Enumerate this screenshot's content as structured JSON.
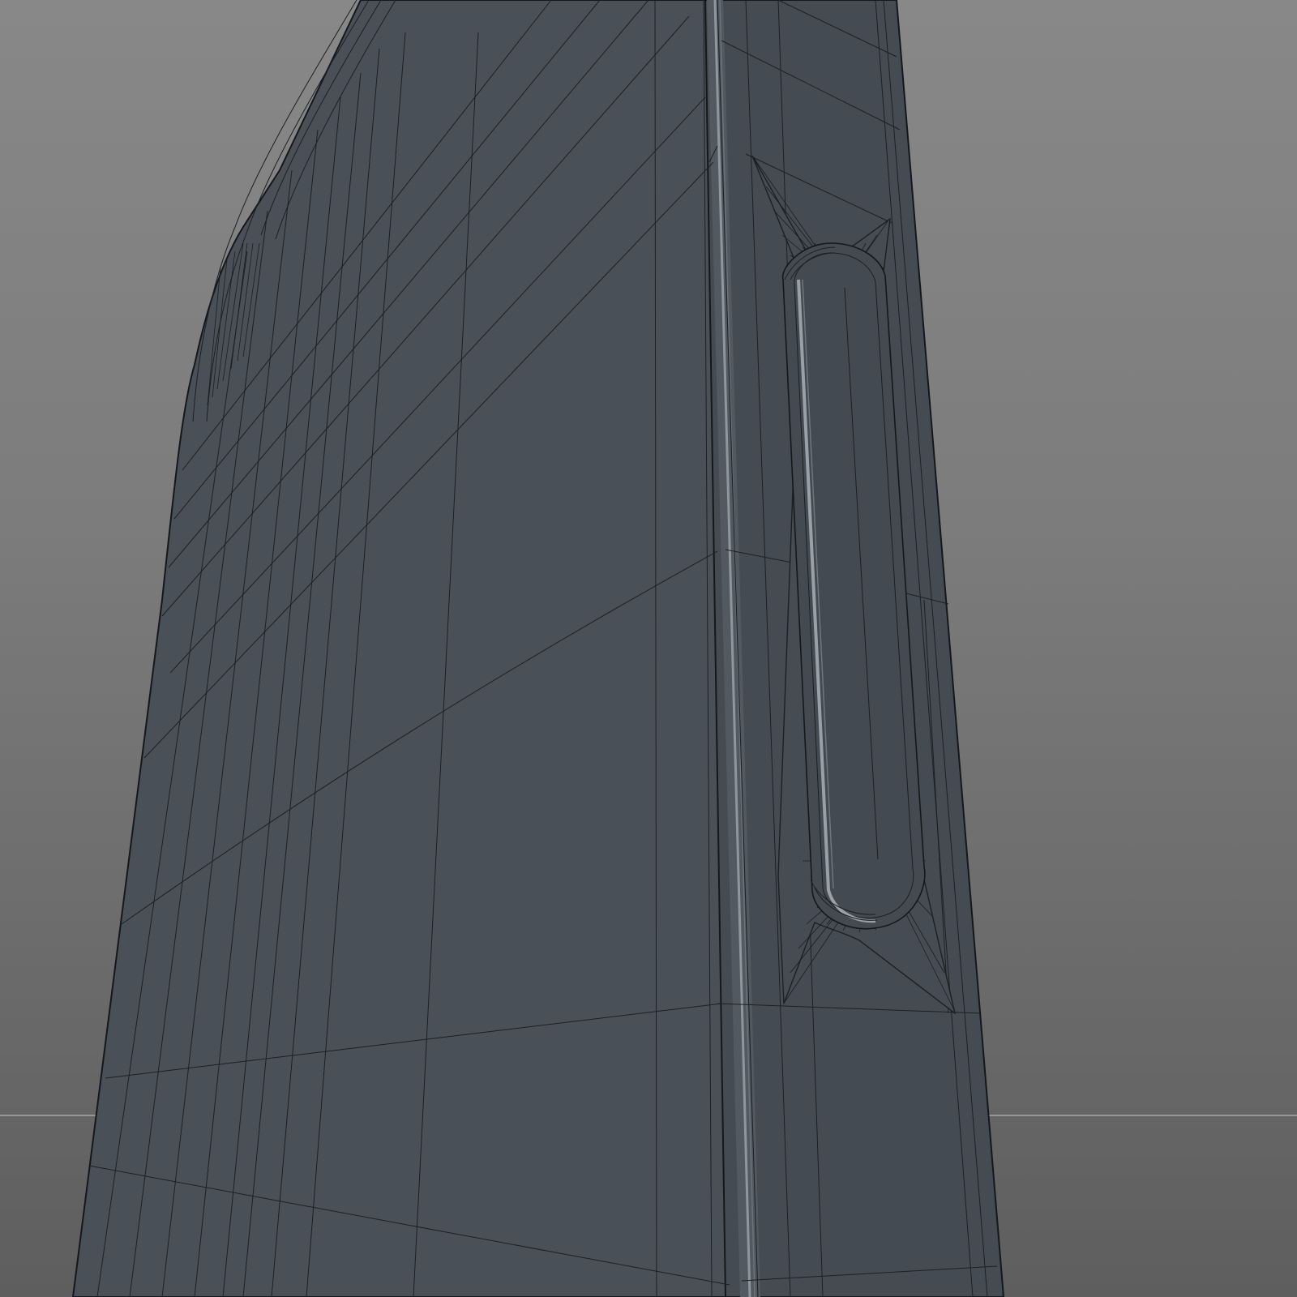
{
  "viewport": {
    "background_top": "#888888",
    "background_bottom": "#5e5e5e",
    "ground_line_color": "#b4b4b4"
  },
  "model": {
    "shading": "solid-wireframe",
    "body_color": "#4a5057",
    "side_color": "#454b52",
    "edge_highlight_color": "#9aa2ab",
    "wire_color": "#1c2024"
  }
}
